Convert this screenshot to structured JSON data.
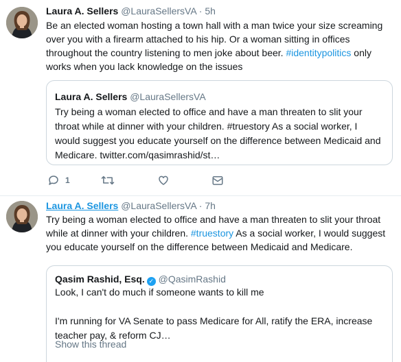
{
  "tweets": [
    {
      "author": "Laura A. Sellers",
      "handle": "@LauraSellersVA",
      "sep": "·",
      "time": "5h",
      "text_a": "Be an elected woman hosting a town hall with a man twice your size screaming over you with a firearm attached to his hip.  Or a woman sitting in offices throughout the country listening to men joke about beer. ",
      "hashtag": "#identitypolitics",
      "text_b": " only works when you lack knowledge on the issues",
      "quote": {
        "author": "Laura A. Sellers",
        "handle": "@LauraSellersVA",
        "text": "Try being a woman elected to office and have a man threaten to slit your throat while at dinner with your children.  #truestory As a social worker, I would suggest you educate yourself on the difference between Medicaid and Medicare. twitter.com/qasimrashid/st…"
      },
      "actions": {
        "reply_count": "1"
      }
    },
    {
      "author": "Laura A. Sellers",
      "handle": "@LauraSellersVA",
      "sep": "·",
      "time": "7h",
      "text_a": "Try being a woman elected to office and have a man threaten to slit your throat while at dinner with your children.  ",
      "hashtag": "#truestory",
      "text_b": " As a social worker, I would suggest you educate yourself on the difference between Medicaid and Medicare.",
      "quote": {
        "author": "Qasim Rashid, Esq.",
        "verified_mark": "✓",
        "handle": "@QasimRashid",
        "line1": "Look, I can't do much if someone wants to kill me",
        "line2": "I'm running for VA Senate to pass Medicare for All, ratify the ERA, increase teacher pay, & reform CJ…",
        "show_thread": "Show this thread"
      }
    }
  ],
  "colors": {
    "link": "#1b95e0",
    "muted": "#657786",
    "border": "#ccd6dd"
  }
}
